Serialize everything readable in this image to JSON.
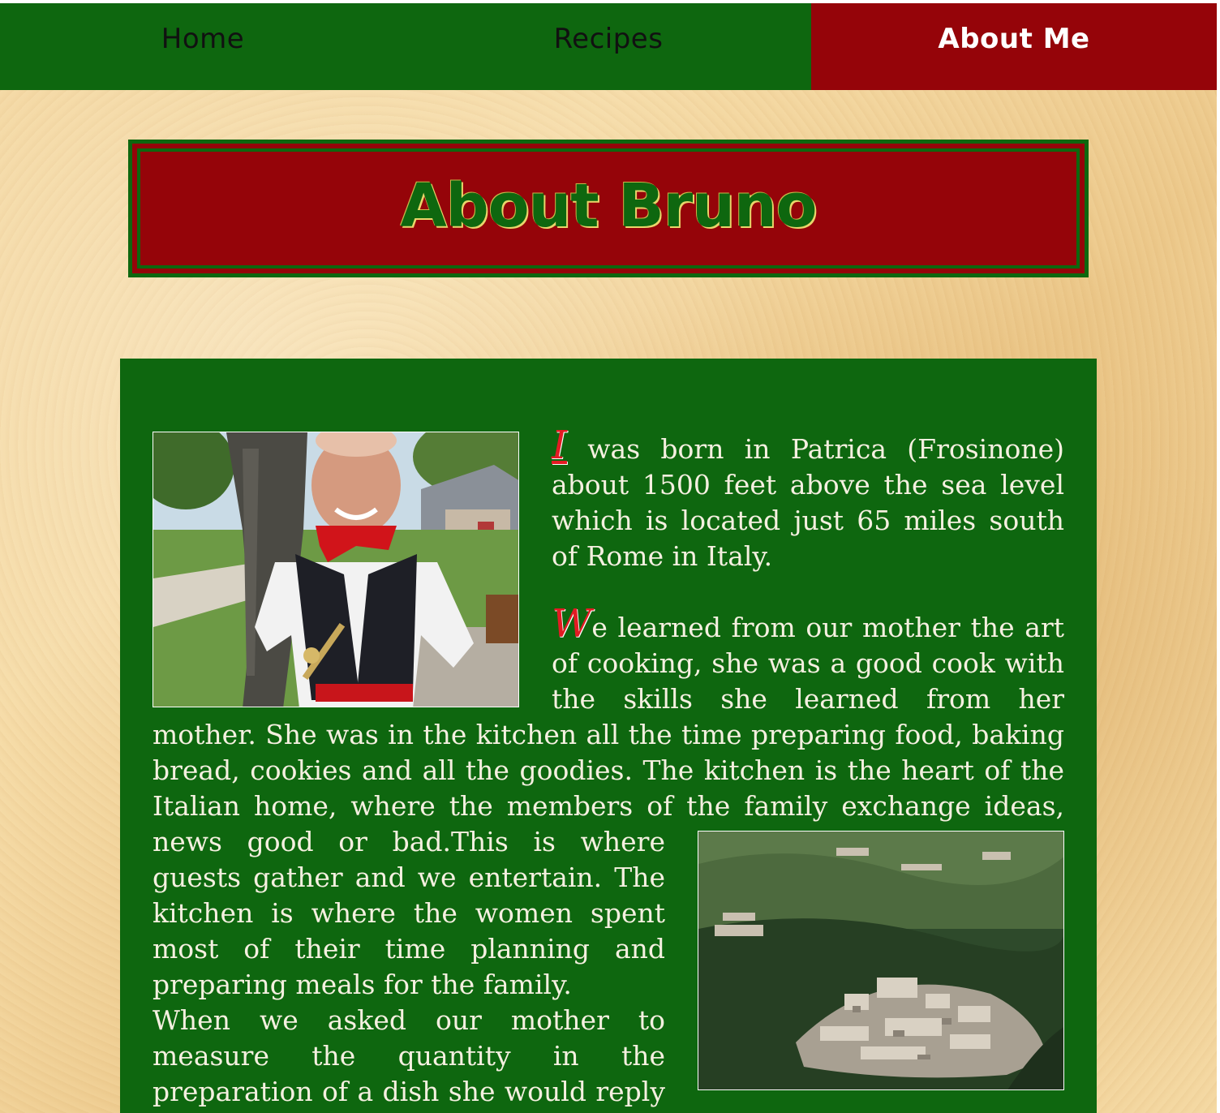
{
  "nav": {
    "items": [
      {
        "label": "Home",
        "active": false
      },
      {
        "label": "Recipes",
        "active": false
      },
      {
        "label": "About Me",
        "active": true
      }
    ]
  },
  "page": {
    "title": "About Bruno"
  },
  "content": {
    "para1_dropcap": "I",
    "para1_rest": " was born in Patrica (Frosinone) about 1500 feet above the sea level which is located just 65 miles south of Rome in Italy.",
    "para2_dropcap": "W",
    "para2_rest": "e learned from our mother the art of cooking, she was a good cook with the skills she learned from her mother. She was in the kitchen all the time preparing food, baking bread, cookies and all the goodies. The kitchen is the heart of the Italian home, where the members of the family exchange ideas, news good or bad.This is where guests gather and we entertain. The kitchen is where the women spent most of their time planning and preparing meals for the family.",
    "para3": "When we asked our mother to measure the quantity in the preparation of a dish she would reply \"un pizzico\" (pinch),\""
  },
  "images": {
    "photo1_subject": "portrait-photo",
    "photo2_subject": "village-aerial-photo"
  },
  "colors": {
    "green": "#0e670f",
    "red": "#950409",
    "dropcap": "#e31b23",
    "text": "#f5f0e0"
  }
}
